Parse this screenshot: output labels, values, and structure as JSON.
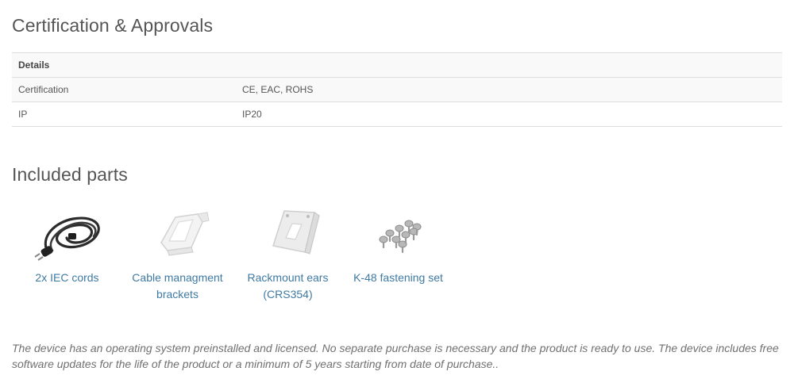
{
  "certification": {
    "title": "Certification & Approvals",
    "header": "Details",
    "rows": [
      {
        "label": "Certification",
        "value": "CE, EAC, ROHS"
      },
      {
        "label": "IP",
        "value": "IP20"
      }
    ]
  },
  "included_parts": {
    "title": "Included parts",
    "items": [
      {
        "label": "2x IEC cords",
        "icon": "power-cord-icon"
      },
      {
        "label": "Cable managment brackets",
        "icon": "cable-bracket-icon"
      },
      {
        "label": "Rackmount ears (CRS354)",
        "icon": "rackmount-ear-icon"
      },
      {
        "label": "K-48 fastening set",
        "icon": "screws-icon"
      }
    ]
  },
  "note": "The device has an operating system preinstalled and licensed. No separate purchase is necessary and the product is ready to use. The device includes free software updates for the life of the product or a minimum of 5 years starting from date of purchase..",
  "colors": {
    "link": "#3f7aa3",
    "text": "#555555",
    "border": "#dddddd"
  }
}
